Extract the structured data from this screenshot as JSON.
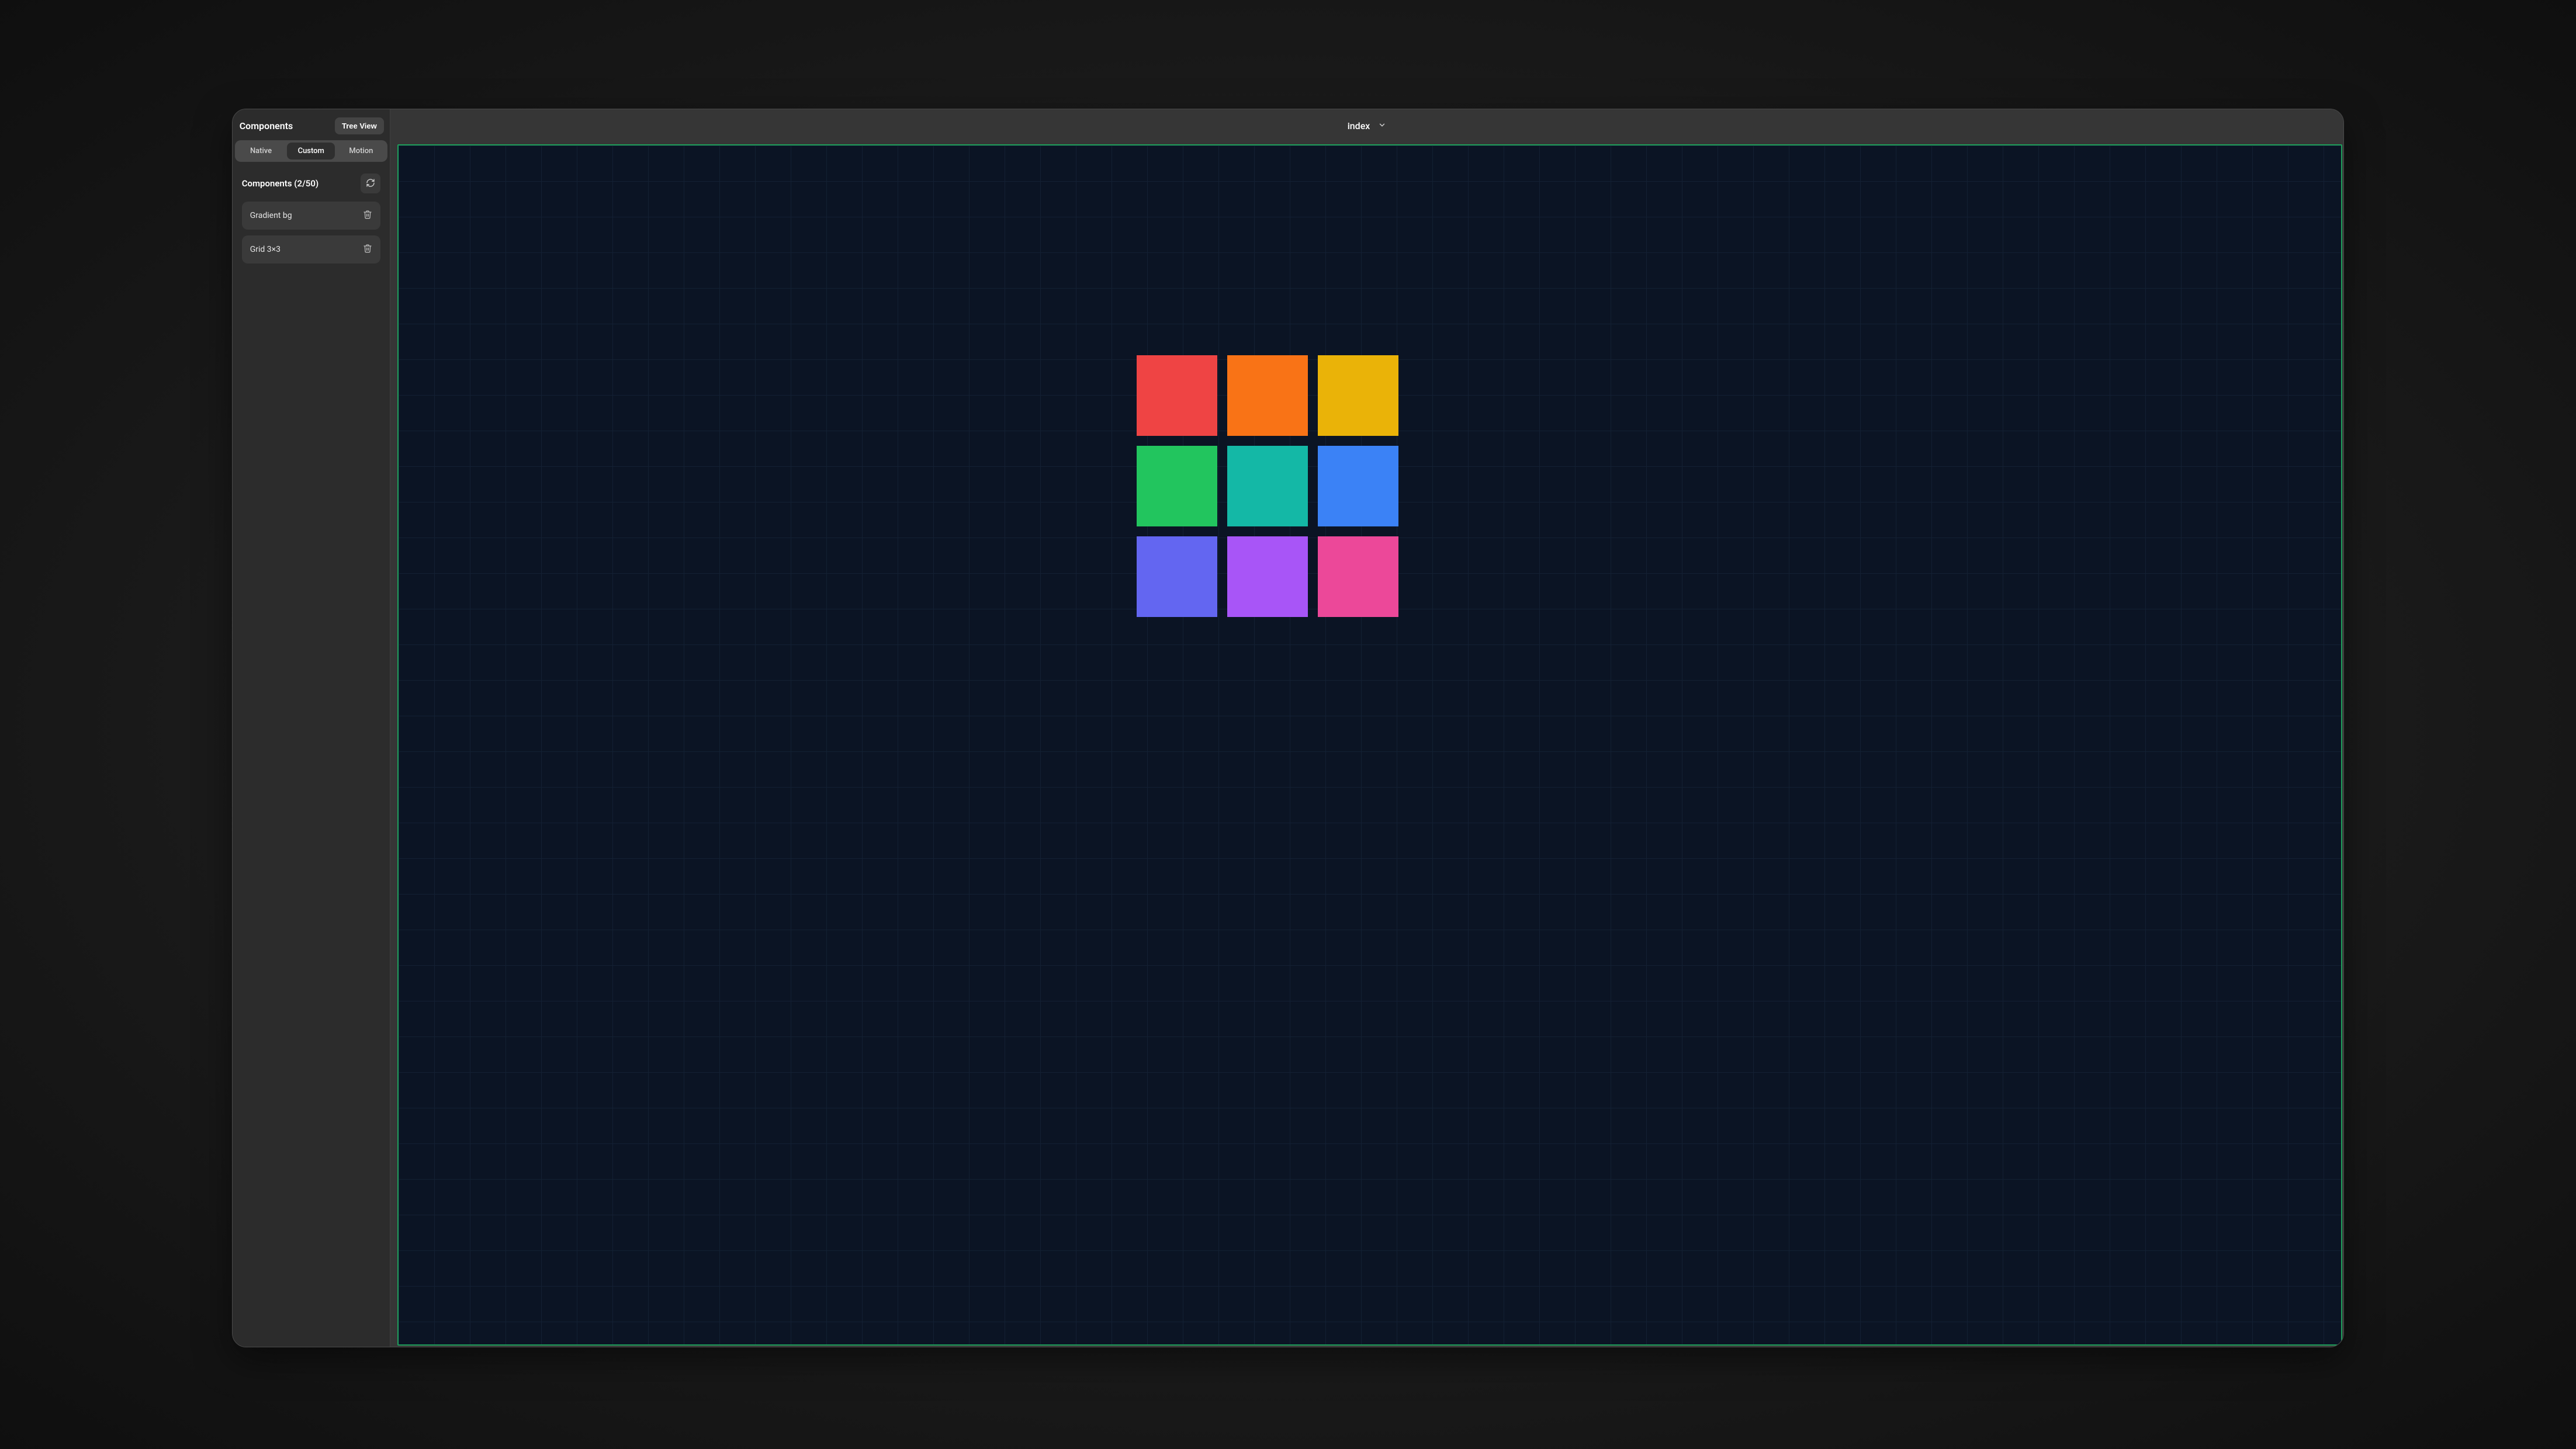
{
  "titlebar": {
    "page_name": "index"
  },
  "sidebar": {
    "title": "Components",
    "tree_view_label": "Tree View",
    "tabs": [
      {
        "label": "Native",
        "active": false
      },
      {
        "label": "Custom",
        "active": true
      },
      {
        "label": "Motion",
        "active": false
      }
    ],
    "section_title": "Components (2/50)",
    "items": [
      {
        "label": "Gradient bg"
      },
      {
        "label": "Grid 3×3"
      }
    ]
  },
  "canvas": {
    "background": "#0b1424",
    "border": "#1e9e5a",
    "grid_colors": [
      "#ef4444",
      "#f97316",
      "#eab308",
      "#22c55e",
      "#14b8a6",
      "#3b82f6",
      "#6366f1",
      "#a855f7",
      "#ec4899"
    ]
  }
}
